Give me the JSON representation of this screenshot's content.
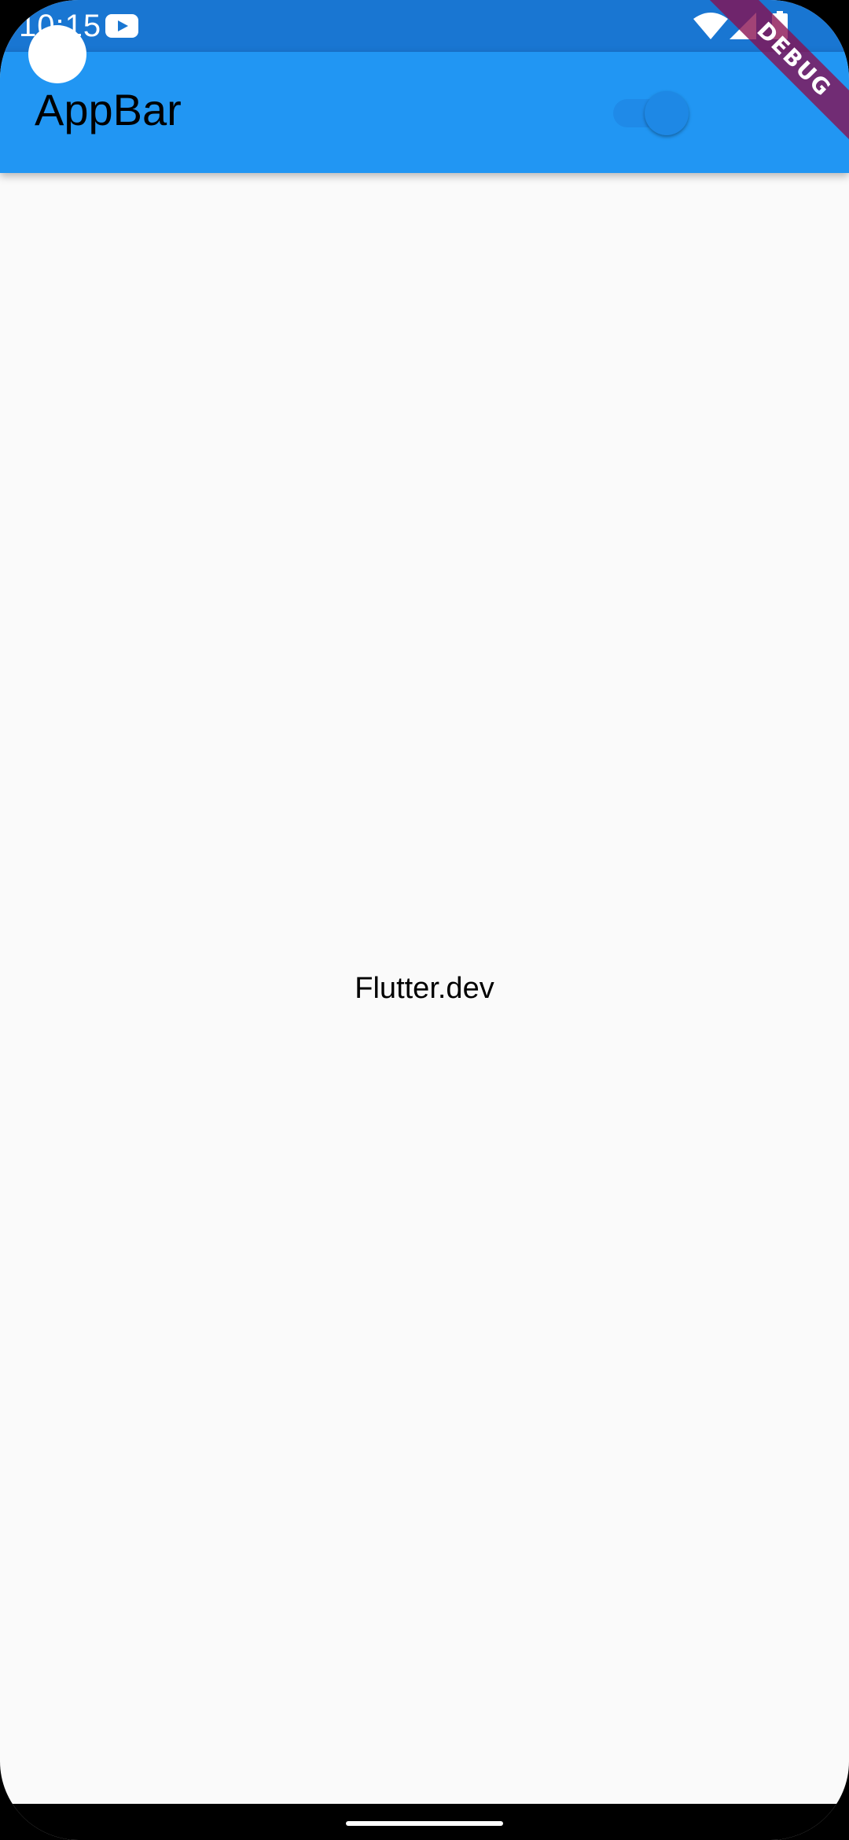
{
  "status_bar": {
    "time": "10:15",
    "notification_icon": "youtube-icon",
    "icons": [
      "wifi-icon",
      "signal-icon",
      "battery-icon"
    ]
  },
  "app_bar": {
    "title": "AppBar",
    "switch": {
      "on": true
    }
  },
  "debug_banner": {
    "label": "DEBUG"
  },
  "body": {
    "text": "Flutter.dev"
  },
  "colors": {
    "status_bar": "#1976d2",
    "app_bar": "#2196f3",
    "switch_active": "#1e88e5",
    "background": "#fafafa",
    "debug_banner": "#880e4f"
  }
}
